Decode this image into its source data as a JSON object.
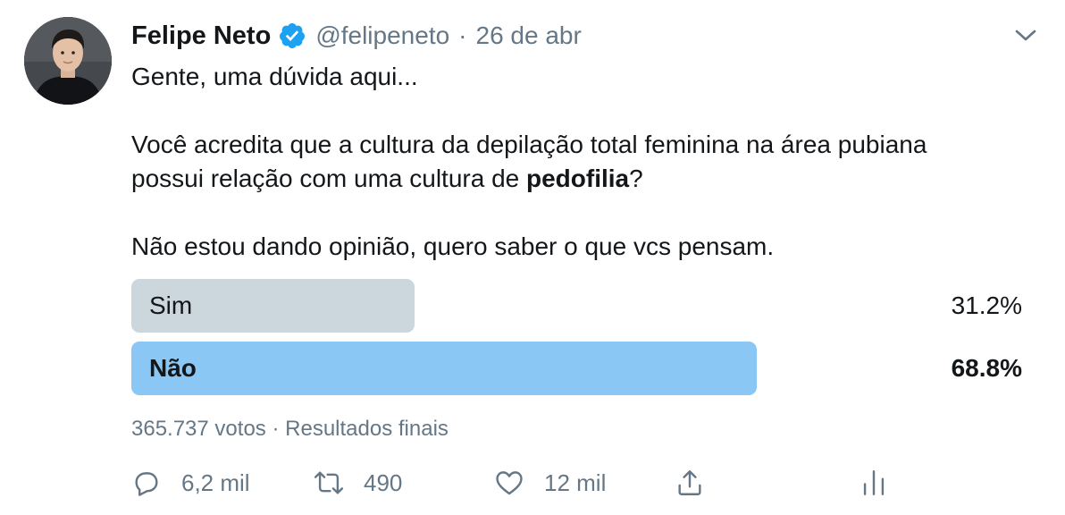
{
  "tweet": {
    "author_name": "Felipe Neto",
    "handle": "@felipeneto",
    "separator": "·",
    "date": "26 de abr",
    "text_line1": "Gente, uma dúvida aqui...",
    "text_line2": "Você acredita que a cultura da depilação total feminina na área pubiana",
    "text_line3_prefix": "possui relação com uma cultura de ",
    "text_line3_bold": "pedofilia",
    "text_line3_suffix": "?",
    "text_line4": "Não estou dando opinião, quero saber o que vcs pensam."
  },
  "poll": {
    "options": [
      {
        "label": "Sim",
        "percent_label": "31.2%",
        "percent": 31.2,
        "winner": false
      },
      {
        "label": "Não",
        "percent_label": "68.8%",
        "percent": 68.8,
        "winner": true
      }
    ],
    "votes": "365.737 votos",
    "status": "Resultados finais",
    "colors": {
      "winner": "#8ac7f4",
      "other": "#ccd6dd"
    }
  },
  "actions": {
    "replies": "6,2 mil",
    "retweets": "490",
    "likes": "12 mil"
  },
  "icons": {
    "verified": "verified-badge-icon",
    "caret": "chevron-down-icon",
    "reply": "reply-icon",
    "retweet": "retweet-icon",
    "like": "heart-icon",
    "share": "share-icon",
    "analytics": "analytics-icon"
  }
}
